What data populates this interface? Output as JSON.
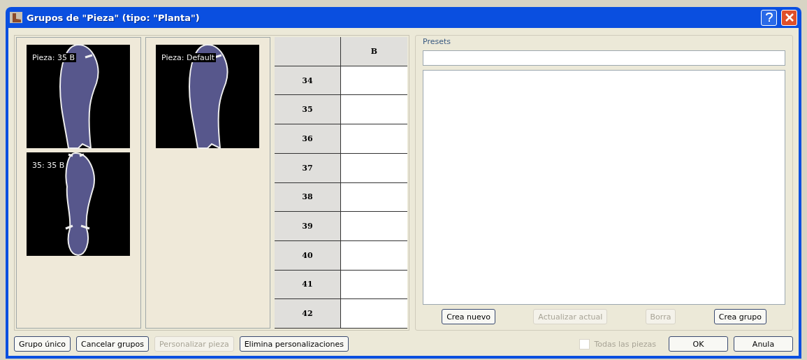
{
  "window": {
    "title": "Grupos de \"Pieza\" (tipo: \"Planta\")"
  },
  "piece_columns": [
    {
      "thumbnails": [
        {
          "label": "Pieza: 35 B",
          "kind": "single"
        },
        {
          "label": "35: 35 B",
          "kind": "split"
        }
      ]
    },
    {
      "thumbnails": [
        {
          "label": "Pieza: Default",
          "kind": "single"
        }
      ]
    }
  ],
  "size_table": {
    "columns": [
      "",
      "B"
    ],
    "rows": [
      {
        "size": "34"
      },
      {
        "size": "35"
      },
      {
        "size": "36"
      },
      {
        "size": "37"
      },
      {
        "size": "38"
      },
      {
        "size": "39"
      },
      {
        "size": "40"
      },
      {
        "size": "41"
      },
      {
        "size": "42"
      }
    ]
  },
  "presets": {
    "title": "Presets",
    "buttons": [
      {
        "label": "Crea nuevo",
        "disabled": false
      },
      {
        "label": "Actualizar actual",
        "disabled": true
      },
      {
        "label": "Borra",
        "disabled": true
      },
      {
        "label": "Crea grupo",
        "disabled": false
      }
    ]
  },
  "bottom_buttons": [
    {
      "label": "Grupo único",
      "disabled": false
    },
    {
      "label": "Cancelar grupos",
      "disabled": false
    },
    {
      "label": "Personalizar pieza",
      "disabled": true
    },
    {
      "label": "Elimina personalizaciones",
      "disabled": false
    }
  ],
  "all_pieces": {
    "label": "Todas las piezas",
    "checked": false,
    "disabled": true
  },
  "dialog_buttons": [
    {
      "label": "OK"
    },
    {
      "label": "Anula"
    }
  ]
}
